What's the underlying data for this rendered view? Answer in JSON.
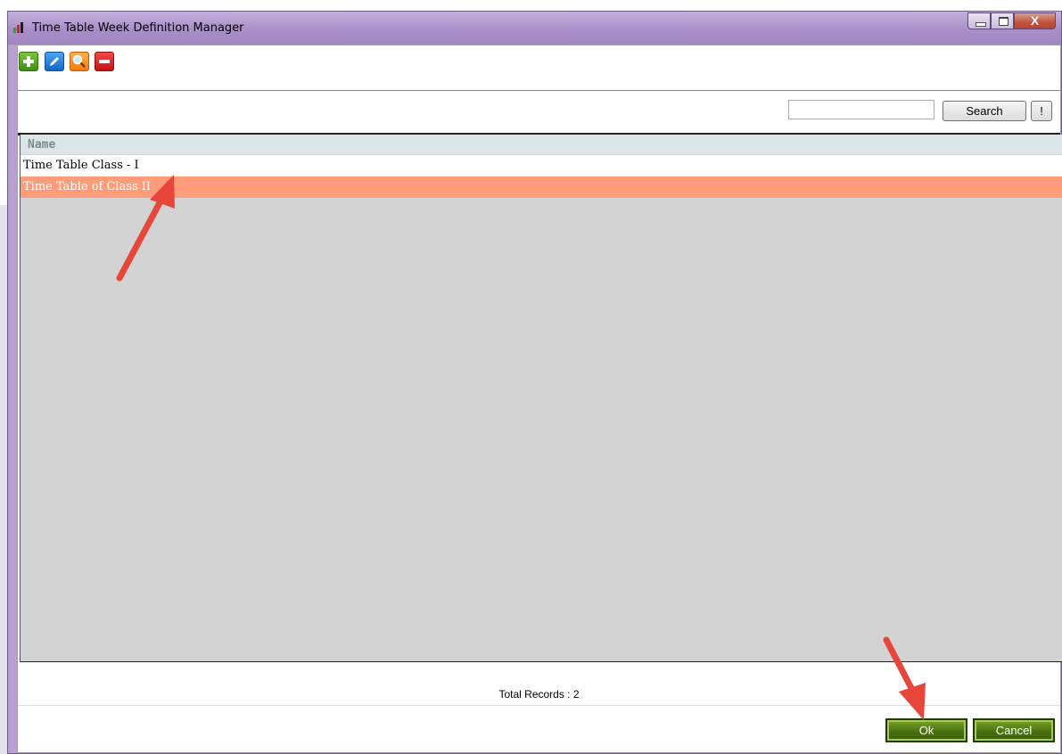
{
  "window": {
    "title": "Time Table Week Definition Manager",
    "caption_minimize": "–",
    "caption_close": "X"
  },
  "toolbar": {
    "add_icon": "plus-icon",
    "edit_icon": "pencil-icon",
    "view_icon": "magnifier-icon",
    "delete_icon": "minus-icon"
  },
  "search": {
    "value": "",
    "button_label": "Search",
    "bang_label": "!"
  },
  "grid": {
    "column_header": "Name",
    "rows": [
      {
        "name": "Time Table Class - I",
        "selected": false
      },
      {
        "name": "Time Table of Class II",
        "selected": true
      }
    ]
  },
  "footer": {
    "total_records": "Total Records : 2",
    "ok_label": "Ok",
    "cancel_label": "Cancel"
  },
  "colors": {
    "titlebar": "#a98ec8",
    "selected_row": "#ff9d7b",
    "button_green": "#476e0d",
    "annotation_arrow": "#e8453b"
  }
}
